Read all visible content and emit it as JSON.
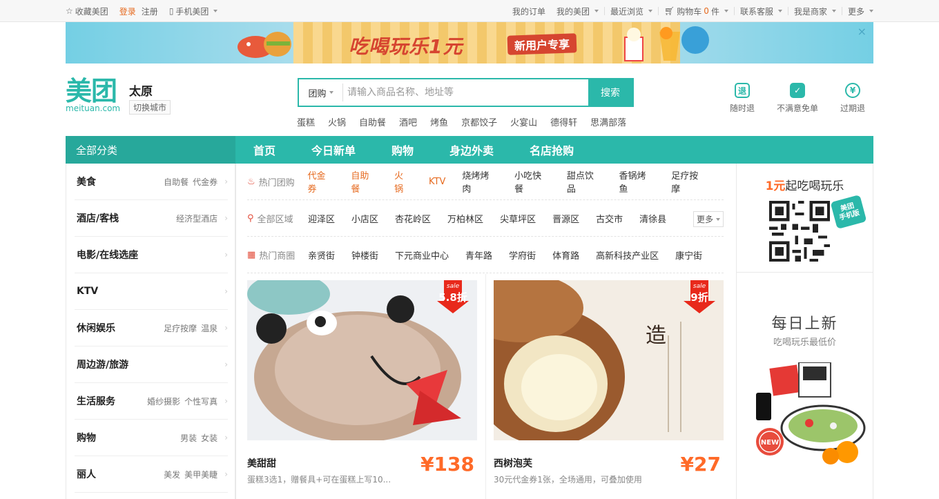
{
  "topbar": {
    "favorite": "收藏美团",
    "login": "登录",
    "register": "注册",
    "mobile": "手机美团",
    "my_orders": "我的订单",
    "my_meituan": "我的美团",
    "recent": "最近浏览",
    "cart_prefix": "购物车",
    "cart_count": "0",
    "cart_suffix": "件",
    "support": "联系客服",
    "merchant": "我是商家",
    "more": "更多"
  },
  "banner": {
    "title": "吃喝玩乐1元",
    "tag": "新用户专享",
    "close": "×"
  },
  "header": {
    "logo_cn": "美团",
    "logo_en": "meituan.com",
    "city": "太原",
    "switch_city": "切换城市"
  },
  "search": {
    "category": "团购",
    "placeholder": "请输入商品名称、地址等",
    "button": "搜索",
    "hotwords": [
      "蛋糕",
      "火锅",
      "自助餐",
      "酒吧",
      "烤鱼",
      "京都饺子",
      "火宴山",
      "德得轩",
      "思满部落"
    ]
  },
  "guarantees": [
    {
      "icon": "退",
      "label": "随时退"
    },
    {
      "icon": "✓",
      "label": "不满意免单"
    },
    {
      "icon": "¥",
      "label": "过期退"
    }
  ],
  "nav": {
    "all": "全部分类",
    "items": [
      "首页",
      "今日新单",
      "购物",
      "身边外卖",
      "名店抢购"
    ]
  },
  "categories": [
    {
      "name": "美食",
      "subs": [
        "自助餐",
        "代金券"
      ]
    },
    {
      "name": "酒店/客栈",
      "subs": [
        "经济型酒店"
      ]
    },
    {
      "name": "电影/在线选座",
      "subs": []
    },
    {
      "name": "KTV",
      "subs": []
    },
    {
      "name": "休闲娱乐",
      "subs": [
        "足疗按摩",
        "温泉"
      ]
    },
    {
      "name": "周边游/旅游",
      "subs": []
    },
    {
      "name": "生活服务",
      "subs": [
        "婚纱摄影",
        "个性写真"
      ]
    },
    {
      "name": "购物",
      "subs": [
        "男装",
        "女装"
      ]
    },
    {
      "name": "丽人",
      "subs": [
        "美发",
        "美甲美睫"
      ]
    }
  ],
  "filters": {
    "hot_deals": {
      "label": "热门团购",
      "items": [
        "代金券",
        "自助餐",
        "火锅",
        "KTV",
        "烧烤烤肉",
        "小吃快餐",
        "甜点饮品",
        "香锅烤鱼",
        "足疗按摩"
      ],
      "hot_count": 4
    },
    "areas": {
      "label": "全部区域",
      "items": [
        "迎泽区",
        "小店区",
        "杏花岭区",
        "万柏林区",
        "尖草坪区",
        "晋源区",
        "古交市",
        "清徐县"
      ],
      "more": "更多"
    },
    "districts": {
      "label": "热门商圈",
      "items": [
        "亲贤街",
        "钟楼街",
        "下元商业中心",
        "青年路",
        "学府街",
        "体育路",
        "高新科技产业区",
        "康宁街"
      ]
    }
  },
  "deals": [
    {
      "title": "美甜甜",
      "desc": "蛋糕3选1，赠餐具+可在蛋糕上写10...",
      "price": "¥138",
      "sale_word": "sale",
      "discount": "5.8折"
    },
    {
      "title": "西树泡芙",
      "desc": "30元代金券1张，全场通用，可叠加使用",
      "price": "¥27",
      "sale_word": "sale",
      "discount": "9折"
    }
  ],
  "right": {
    "qr_prefix": "1元",
    "qr_title": "起吃喝玩乐",
    "badge_line1": "美团",
    "badge_line2": "手机版",
    "daily_title": "每日上新",
    "daily_sub": "吃喝玩乐最低价",
    "new_badge": "NEW"
  },
  "colors": {
    "brand": "#2bb8aa",
    "price": "#ff6a28",
    "hot": "#e66a1f"
  }
}
